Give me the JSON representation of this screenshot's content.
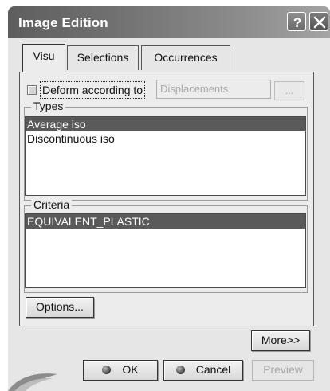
{
  "window": {
    "title": "Image Edition",
    "help_icon": "question-mark-icon",
    "close_icon": "close-icon",
    "help_glyph": "?",
    "close_glyph": "✕"
  },
  "tabs": [
    {
      "label": "Visu",
      "active": true
    },
    {
      "label": "Selections",
      "active": false
    },
    {
      "label": "Occurrences",
      "active": false
    }
  ],
  "deform": {
    "checkbox_checked": false,
    "label": "Deform according to",
    "field_value": "Displacements",
    "browse_label": "...",
    "enabled": false
  },
  "types": {
    "legend": "Types",
    "items": [
      {
        "label": "Average iso",
        "selected": true
      },
      {
        "label": "Discontinuous iso",
        "selected": false
      }
    ]
  },
  "criteria": {
    "legend": "Criteria",
    "items": [
      {
        "label": "EQUIVALENT_PLASTIC",
        "selected": true
      }
    ]
  },
  "buttons": {
    "options": "Options...",
    "more": "More>>",
    "ok": "OK",
    "cancel": "Cancel",
    "preview": "Preview"
  },
  "colors": {
    "selection": "#5a5a5a",
    "title_bar": "#6a6a6a"
  }
}
